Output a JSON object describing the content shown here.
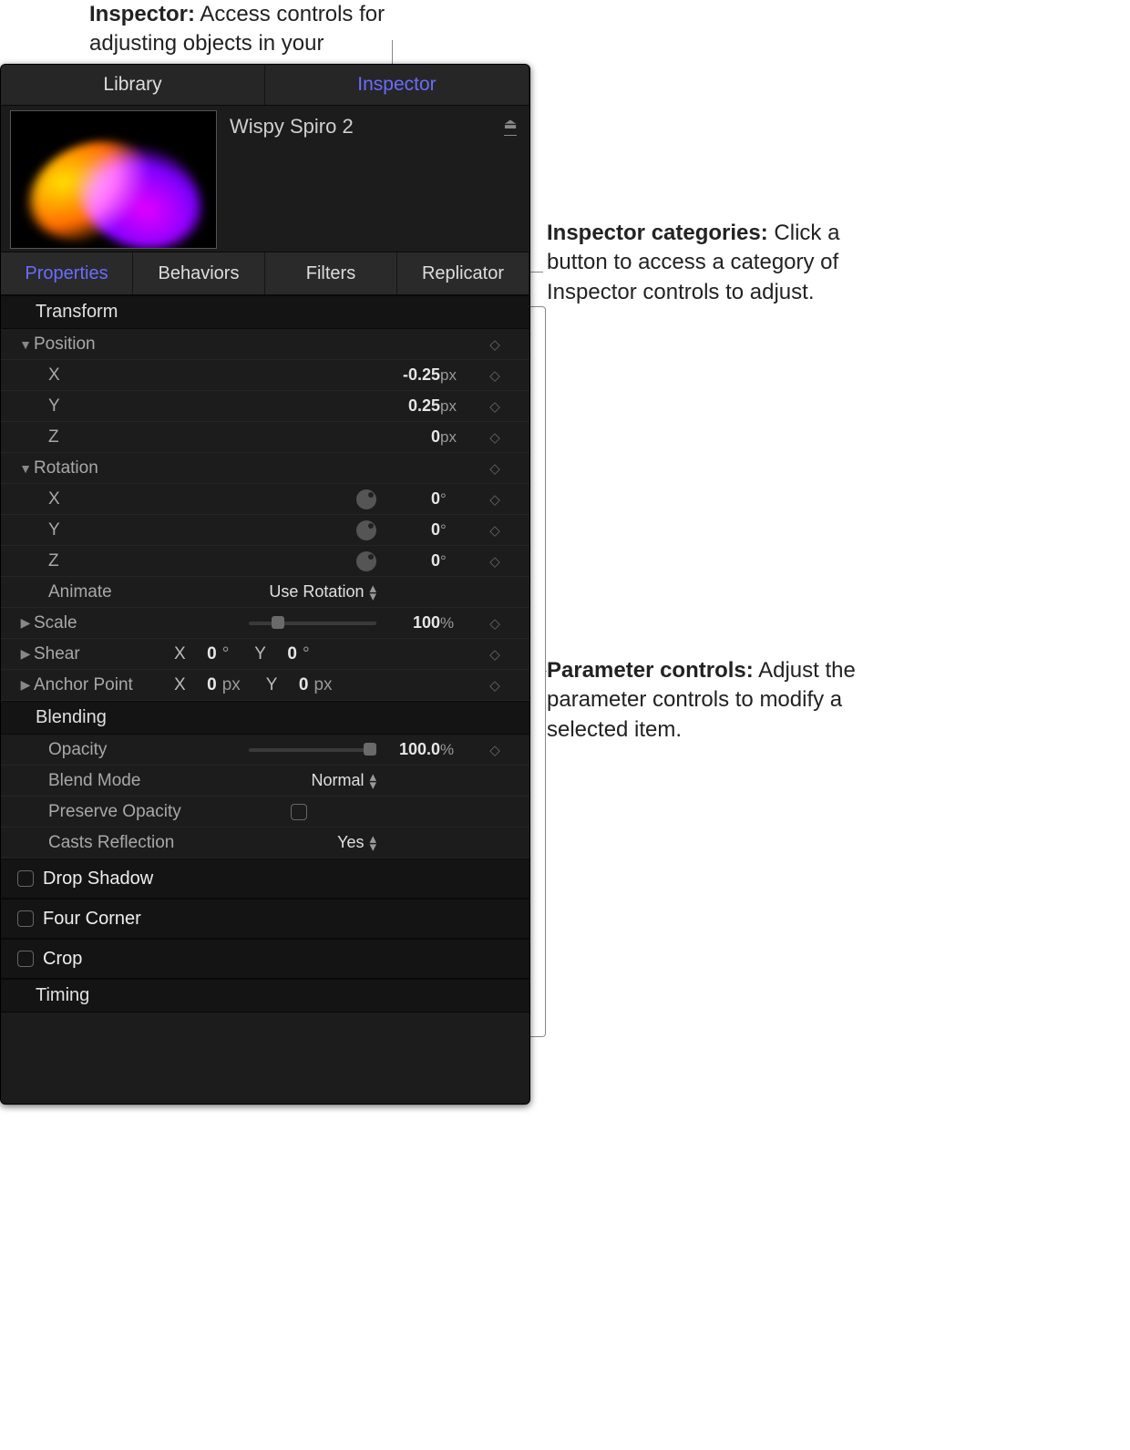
{
  "callouts": {
    "top": {
      "bold": "Inspector:",
      "text": " Access controls for adjusting objects in your project."
    },
    "categories": {
      "bold": "Inspector categories:",
      "text": " Click a button to access a category of Inspector controls to adjust."
    },
    "params": {
      "bold": "Parameter controls:",
      "text": " Adjust the parameter controls to modify a selected item."
    }
  },
  "tabs": {
    "library": "Library",
    "inspector": "Inspector"
  },
  "object_name": "Wispy Spiro 2",
  "categories": {
    "properties": "Properties",
    "behaviors": "Behaviors",
    "filters": "Filters",
    "replicator": "Replicator"
  },
  "sections": {
    "transform": "Transform",
    "blending": "Blending",
    "drop_shadow": "Drop Shadow",
    "four_corner": "Four Corner",
    "crop": "Crop",
    "timing": "Timing"
  },
  "labels": {
    "position": "Position",
    "x": "X",
    "y": "Y",
    "z": "Z",
    "rotation": "Rotation",
    "animate": "Animate",
    "scale": "Scale",
    "shear": "Shear",
    "anchor": "Anchor Point",
    "opacity": "Opacity",
    "blend_mode": "Blend Mode",
    "preserve_opacity": "Preserve Opacity",
    "casts_reflection": "Casts Reflection"
  },
  "values": {
    "pos_x": "-0.25",
    "pos_y": "0.25",
    "pos_z": "0",
    "rot_x": "0",
    "rot_y": "0",
    "rot_z": "0",
    "animate": "Use Rotation",
    "scale": "100",
    "shear_x": "0",
    "shear_y": "0",
    "anchor_x": "0",
    "anchor_y": "0",
    "opacity": "100.0",
    "blend_mode": "Normal",
    "casts_reflection": "Yes"
  },
  "units": {
    "px": "px",
    "deg": "°",
    "pct": "%"
  }
}
